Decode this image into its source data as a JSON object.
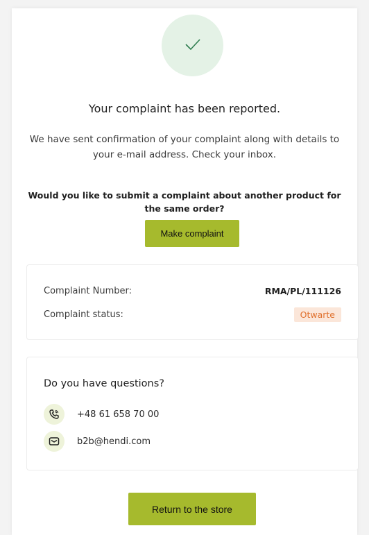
{
  "header": {
    "success_icon": "checkmark-icon",
    "title": "Your complaint has been reported.",
    "description": "We have sent confirmation of your complaint along with details to your e-mail address. Check your inbox.",
    "question": "Would you like to submit a complaint about another product for the same order?"
  },
  "actions": {
    "make_complaint_label": "Make complaint",
    "return_label": "Return to the store"
  },
  "complaint": {
    "number_label": "Complaint Number:",
    "number_value": "RMA/PL/111126",
    "status_label": "Complaint status:",
    "status_value": "Otwarte",
    "status_color": "#e0702d"
  },
  "contact": {
    "title": "Do you have questions?",
    "phone_icon": "phone-icon",
    "phone": "+48 61 658 70 00",
    "email_icon": "mail-icon",
    "email": "b2b@hendi.com"
  },
  "colors": {
    "accent": "#a6ba2d",
    "success_bg": "#e4f2e6",
    "success_check": "#2e7d4f"
  }
}
